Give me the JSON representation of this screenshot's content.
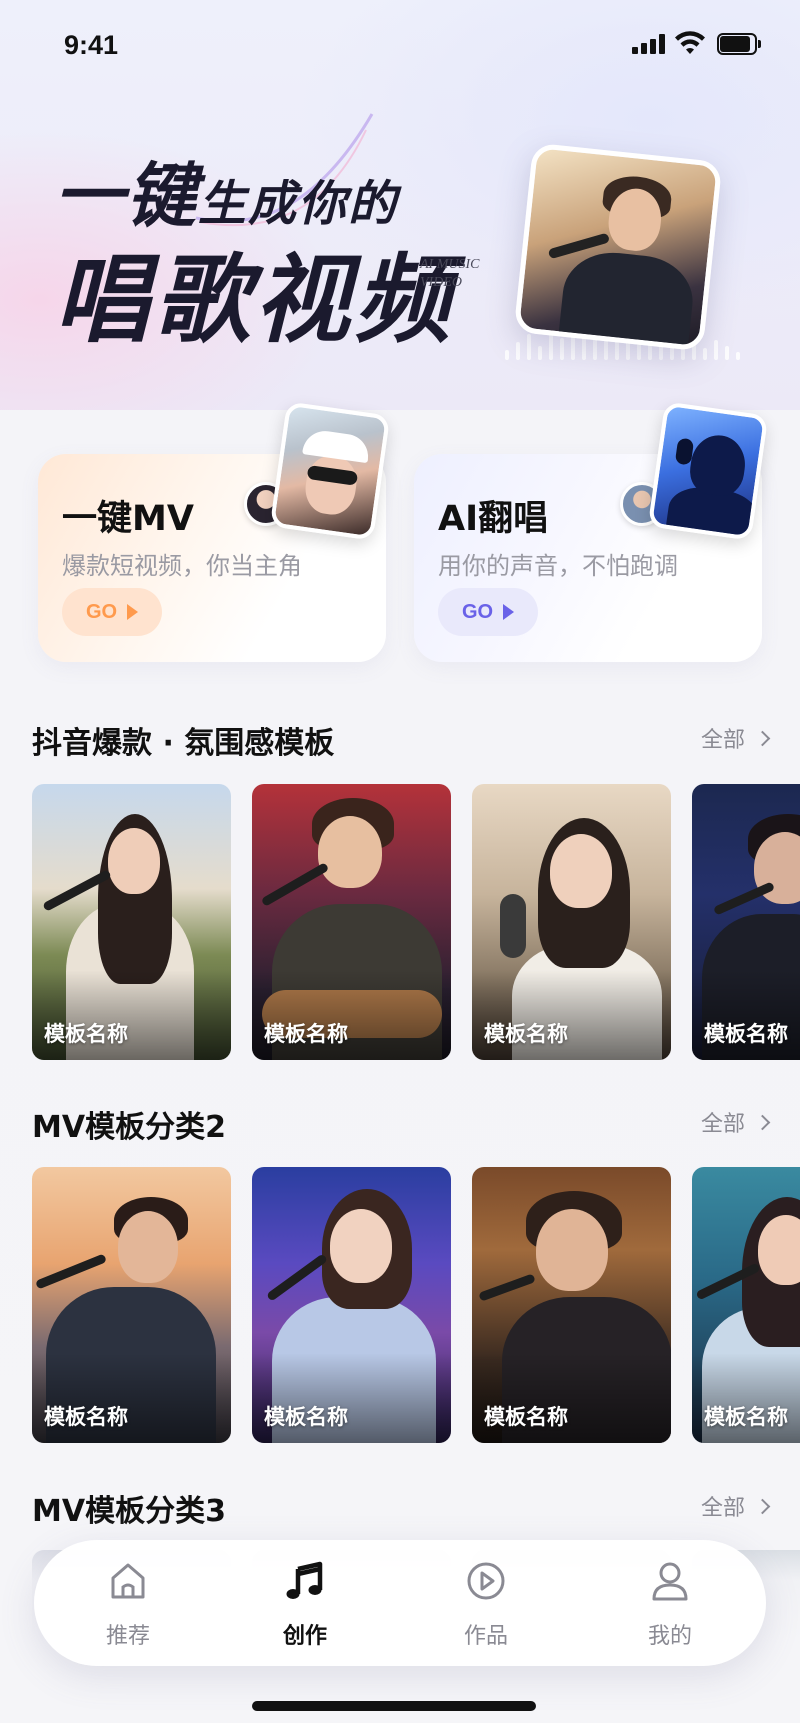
{
  "status_bar": {
    "time": "9:41"
  },
  "hero": {
    "line1_a": "一键",
    "line1_b": "生成",
    "line1_c": "你的",
    "line2": "唱歌视频",
    "tag_line1": "AI MUSIC",
    "tag_line2": "VIDEO"
  },
  "features": [
    {
      "title": "一键MV",
      "subtitle": "爆款短视频，你当主角",
      "go_label": "GO"
    },
    {
      "title": "AI翻唱",
      "subtitle": "用你的声音，不怕跑调",
      "go_label": "GO"
    }
  ],
  "sections": [
    {
      "title": "抖音爆款 · 氛围感模板",
      "more_label": "全部",
      "templates": [
        "模板名称",
        "模板名称",
        "模板名称",
        "模板名称"
      ]
    },
    {
      "title": "MV模板分类2",
      "more_label": "全部",
      "templates": [
        "模板名称",
        "模板名称",
        "模板名称",
        "模板名称"
      ]
    },
    {
      "title": "MV模板分类3",
      "more_label": "全部"
    }
  ],
  "nav": {
    "items": [
      {
        "label": "推荐",
        "icon": "home-icon",
        "active": false
      },
      {
        "label": "创作",
        "icon": "music-note-icon",
        "active": true
      },
      {
        "label": "作品",
        "icon": "play-circle-icon",
        "active": false
      },
      {
        "label": "我的",
        "icon": "user-icon",
        "active": false
      }
    ]
  },
  "colors": {
    "accent_orange": "#ff9a4d",
    "accent_purple": "#6a62e8",
    "text_primary": "#111111",
    "text_secondary": "#8a8a93"
  }
}
